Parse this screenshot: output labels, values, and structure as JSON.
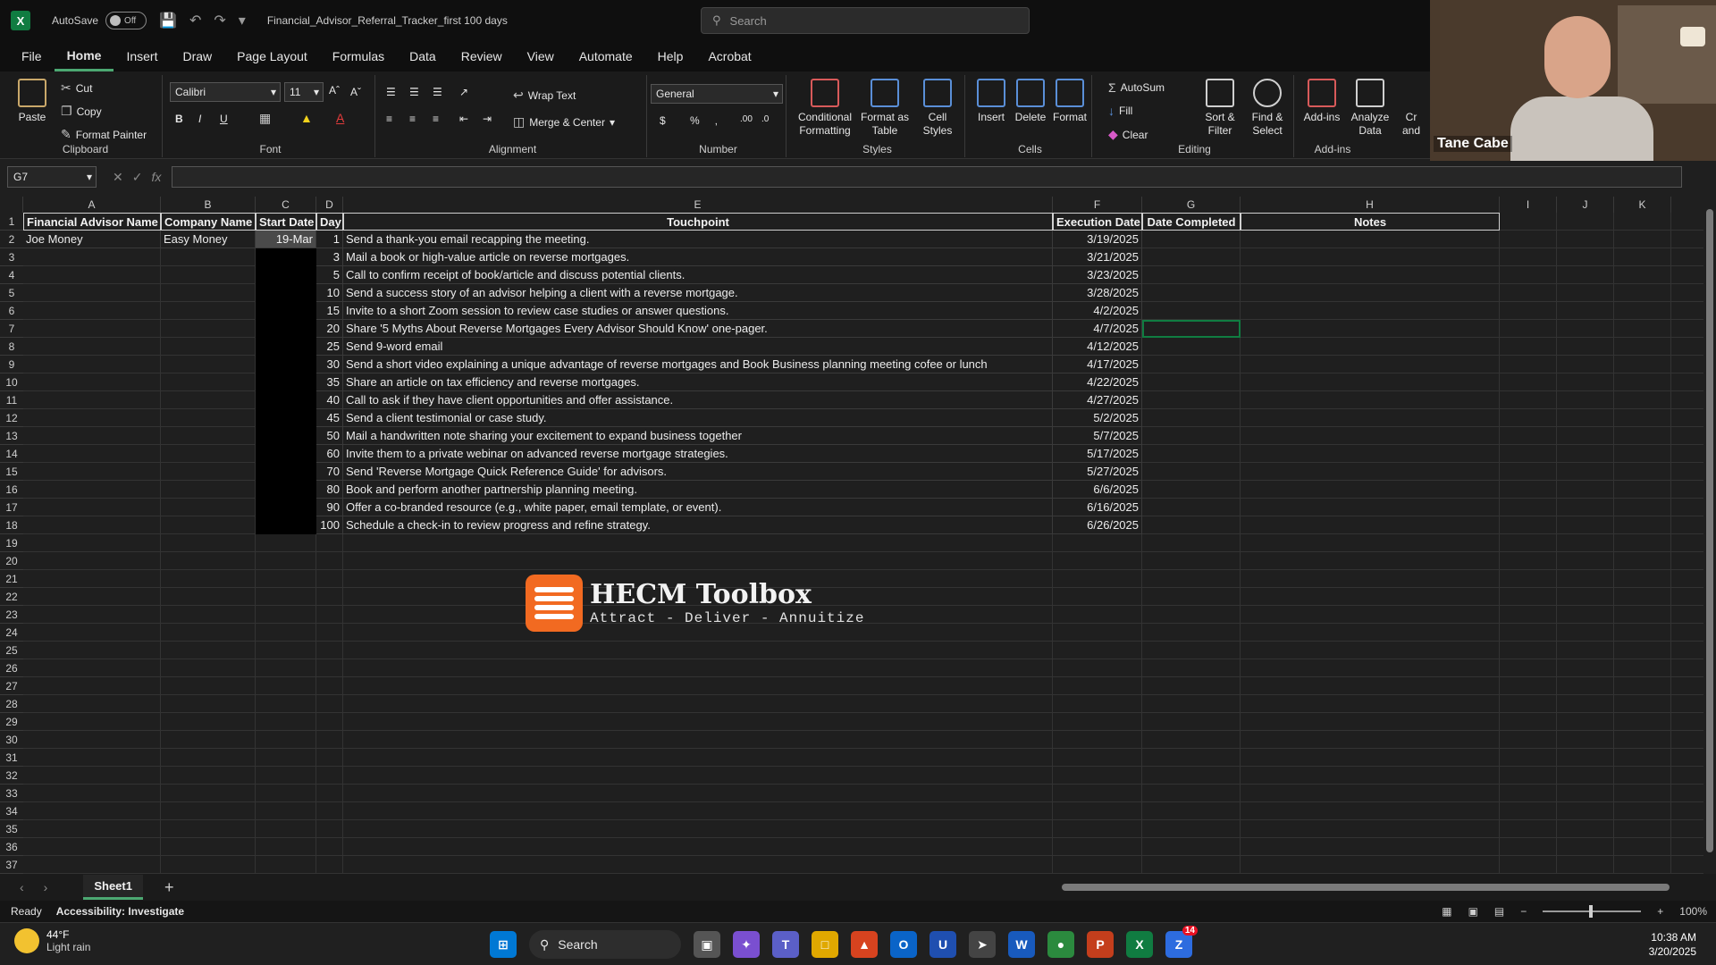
{
  "titlebar": {
    "autosave_label": "AutoSave",
    "autosave_state": "Off",
    "doc_title": "Financial_Advisor_Referral_Tracker_first 100 days",
    "search_placeholder": "Search"
  },
  "menu": [
    "File",
    "Home",
    "Insert",
    "Draw",
    "Page Layout",
    "Formulas",
    "Data",
    "Review",
    "View",
    "Automate",
    "Help",
    "Acrobat"
  ],
  "ribbon": {
    "clipboard": {
      "paste": "Paste",
      "cut": "Cut",
      "copy": "Copy",
      "format_painter": "Format Painter",
      "label": "Clipboard"
    },
    "font": {
      "name": "Calibri",
      "size": "11",
      "label": "Font"
    },
    "alignment": {
      "wrap": "Wrap Text",
      "merge": "Merge & Center",
      "label": "Alignment"
    },
    "number": {
      "format": "General",
      "label": "Number"
    },
    "styles": {
      "conditional": "Conditional Formatting",
      "format_table": "Format as Table",
      "cell_styles": "Cell Styles",
      "label": "Styles"
    },
    "cells": {
      "insert": "Insert",
      "delete": "Delete",
      "format": "Format",
      "label": "Cells"
    },
    "editing": {
      "autosum": "AutoSum",
      "fill": "Fill",
      "clear": "Clear",
      "sort": "Sort & Filter",
      "find": "Find & Select",
      "label": "Editing"
    },
    "addins": {
      "addins": "Add-ins",
      "analyze": "Analyze Data",
      "label": "Add-ins",
      "partial": "Cr and"
    }
  },
  "formula": {
    "namebox": "G7",
    "fx": "fx"
  },
  "columns": [
    "A",
    "B",
    "C",
    "D",
    "E",
    "F",
    "G",
    "H",
    "I",
    "J",
    "K"
  ],
  "headers": {
    "advisor": "Financial Advisor Name",
    "company": "Company Name",
    "start": "Start Date",
    "day": "Day",
    "touchpoint": "Touchpoint",
    "exec": "Execution Date",
    "completed": "Date Completed",
    "notes": "Notes"
  },
  "row2": {
    "advisor": "Joe Money",
    "company": "Easy Money",
    "start": "19-Mar"
  },
  "rows": [
    {
      "day": "1",
      "touchpoint": "Send a thank-you email recapping the meeting.",
      "exec": "3/19/2025"
    },
    {
      "day": "3",
      "touchpoint": "Mail a book or high-value article on reverse mortgages.",
      "exec": "3/21/2025"
    },
    {
      "day": "5",
      "touchpoint": "Call to confirm receipt of book/article and discuss potential clients.",
      "exec": "3/23/2025"
    },
    {
      "day": "10",
      "touchpoint": "Send a success story of an advisor helping a client with a reverse mortgage.",
      "exec": "3/28/2025"
    },
    {
      "day": "15",
      "touchpoint": "Invite to a short Zoom session to review case studies or answer questions.",
      "exec": "4/2/2025"
    },
    {
      "day": "20",
      "touchpoint": "Share '5 Myths About Reverse Mortgages Every Advisor Should Know' one-pager.",
      "exec": "4/7/2025"
    },
    {
      "day": "25",
      "touchpoint": "Send 9-word email",
      "exec": "4/12/2025"
    },
    {
      "day": "30",
      "touchpoint": "Send a short video explaining a unique advantage of reverse mortgages and Book Business planning meeting cofee or lunch",
      "exec": "4/17/2025"
    },
    {
      "day": "35",
      "touchpoint": "Share an article on tax efficiency and reverse mortgages.",
      "exec": "4/22/2025"
    },
    {
      "day": "40",
      "touchpoint": "Call to ask if they have client opportunities and offer assistance.",
      "exec": "4/27/2025"
    },
    {
      "day": "45",
      "touchpoint": "Send a client testimonial or case study.",
      "exec": "5/2/2025"
    },
    {
      "day": "50",
      "touchpoint": "Mail a handwritten note sharing your excitement to expand business together",
      "exec": "5/7/2025"
    },
    {
      "day": "60",
      "touchpoint": "Invite them to a private webinar on advanced reverse mortgage strategies.",
      "exec": "5/17/2025"
    },
    {
      "day": "70",
      "touchpoint": "Send 'Reverse Mortgage Quick Reference Guide' for advisors.",
      "exec": "5/27/2025"
    },
    {
      "day": "80",
      "touchpoint": "Book and perform another partnership planning meeting.",
      "exec": "6/6/2025"
    },
    {
      "day": "90",
      "touchpoint": "Offer a co-branded resource (e.g., white paper, email template, or event).",
      "exec": "6/16/2025"
    },
    {
      "day": "100",
      "touchpoint": "Schedule a check-in to review progress and refine strategy.",
      "exec": "6/26/2025"
    }
  ],
  "logo": {
    "name": "HECM Toolbox",
    "tagline": "Attract - Deliver - Annuitize"
  },
  "sheet_tab": "Sheet1",
  "status": {
    "ready": "Ready",
    "accessibility": "Accessibility: Investigate",
    "zoom": "100%"
  },
  "taskbar": {
    "temp": "44°F",
    "weather": "Light rain",
    "search": "Search",
    "time": "10:38 AM",
    "date": "3/20/2025",
    "badge": "14"
  },
  "webcam": {
    "name": "Tane Cabe"
  }
}
